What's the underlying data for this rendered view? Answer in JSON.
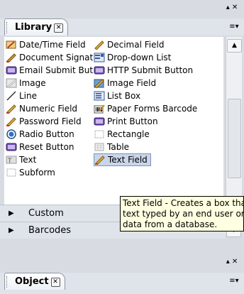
{
  "library_panel": {
    "tab_label": "Library",
    "items": [
      {
        "label": "Date/Time Field",
        "icon": "date-time-field-icon"
      },
      {
        "label": "Decimal Field",
        "icon": "decimal-field-icon"
      },
      {
        "label": "Document Signat",
        "icon": "document-signature-icon"
      },
      {
        "label": "Drop-down List",
        "icon": "drop-down-list-icon"
      },
      {
        "label": "Email Submit But",
        "icon": "email-submit-button-icon"
      },
      {
        "label": "HTTP Submit Button",
        "icon": "http-submit-button-icon"
      },
      {
        "label": "Image",
        "icon": "image-icon"
      },
      {
        "label": "Image Field",
        "icon": "image-field-icon"
      },
      {
        "label": "Line",
        "icon": "line-icon"
      },
      {
        "label": "List Box",
        "icon": "list-box-icon"
      },
      {
        "label": "Numeric Field",
        "icon": "numeric-field-icon"
      },
      {
        "label": "Paper Forms Barcode",
        "icon": "paper-forms-barcode-icon"
      },
      {
        "label": "Password Field",
        "icon": "password-field-icon"
      },
      {
        "label": "Print Button",
        "icon": "print-button-icon"
      },
      {
        "label": "Radio Button",
        "icon": "radio-button-icon"
      },
      {
        "label": "Rectangle",
        "icon": "rectangle-icon"
      },
      {
        "label": "Reset Button",
        "icon": "reset-button-icon"
      },
      {
        "label": "Table",
        "icon": "table-icon"
      },
      {
        "label": "Text",
        "icon": "text-icon"
      },
      {
        "label": "Text Field",
        "icon": "text-field-icon"
      },
      {
        "label": "Subform",
        "icon": "subform-icon"
      }
    ],
    "selected_item": "Text Field",
    "groups": [
      {
        "label": "Custom"
      },
      {
        "label": "Barcodes"
      }
    ],
    "tooltip": {
      "line1": "Text Field - Creates a box tha",
      "line2": "text typed by an end user or",
      "line3": "data from a database."
    }
  },
  "object_panel": {
    "tab_label": "Object"
  },
  "icons": {
    "close": "close-icon",
    "minimize": "minimize-icon",
    "panel_menu": "panel-menu-icon",
    "scroll_up": "scroll-up-icon",
    "scroll_down": "scroll-down-icon"
  }
}
